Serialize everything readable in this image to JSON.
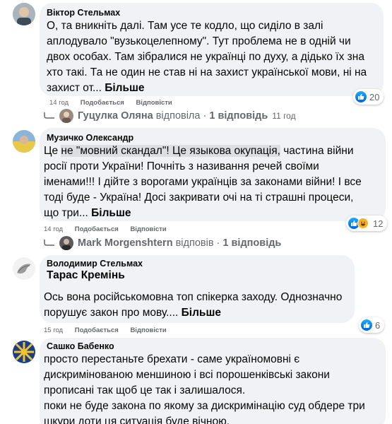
{
  "comments": [
    {
      "author": "Віктор Стельмах",
      "lines": [
        "О, та вникніть далі. Там усе те кодло, що сиділо в залі",
        "аплодувало \"вузькоцелепному\". Тут проблема не в одній чи",
        "двох особах. Там зібралися не українці по духу, а дідько їх зна",
        "хто такі. Та не один не став ні на захист української мови, ні на",
        "захист от..."
      ],
      "more": "Більше",
      "time": "14 год",
      "like": "Подобається",
      "reply": "Відповісти",
      "reaction_count": "20",
      "reply_author": "Гуцулка Оляна",
      "reply_verb": "відповіла",
      "reply_count": "1 відповідь",
      "reply_time": "11 год"
    },
    {
      "author": "Музичко Олександр",
      "line1_before": "Це ",
      "line1_highlight": "не \"мовний скандал\"! Це языкова окупація,",
      "line1_after": " частина війни",
      "lines": [
        "росії проти України! Почніть з називання речей своїми",
        "іменами!!! І дійте з ворогами українців за законами війни! І все",
        "тоді буде - Україна! Досі закривати очі на ті страшні процеси,",
        "що три..."
      ],
      "more": "Більше",
      "time": "14 год",
      "like": "Подобається",
      "reply": "Відповісти",
      "reaction_count": "12",
      "reply_author": "Mark Morgenshtern",
      "reply_verb": "відповів",
      "reply_count": "1 відповідь"
    },
    {
      "author": "Володимир Стельмах",
      "mention": "Тарас Кремінь",
      "lines": [
        "Ось вона російськомовна топ спікерка заходу. Однозначно",
        "порушує закон про мову...."
      ],
      "more": "Більше",
      "time": "15 год",
      "like": "Подобається",
      "reply": "Відповісти",
      "reaction_count": "6"
    },
    {
      "author": "Сашко Бабенко",
      "lines": [
        "просто перестаньте брехати - саме україномовні є",
        "дискримінованою меншиною і всі порошенківські закони",
        "прописані так щоб це так і залишалося.",
        "поки не буде закона по якому за дискримінацію суд обдере три",
        "шкури доти ця ситуація буде вічною."
      ]
    }
  ],
  "colors": {
    "bubble": "#f0f2f5",
    "text": "#050505",
    "meta": "#65676b",
    "like_blue": "#0866ff"
  }
}
